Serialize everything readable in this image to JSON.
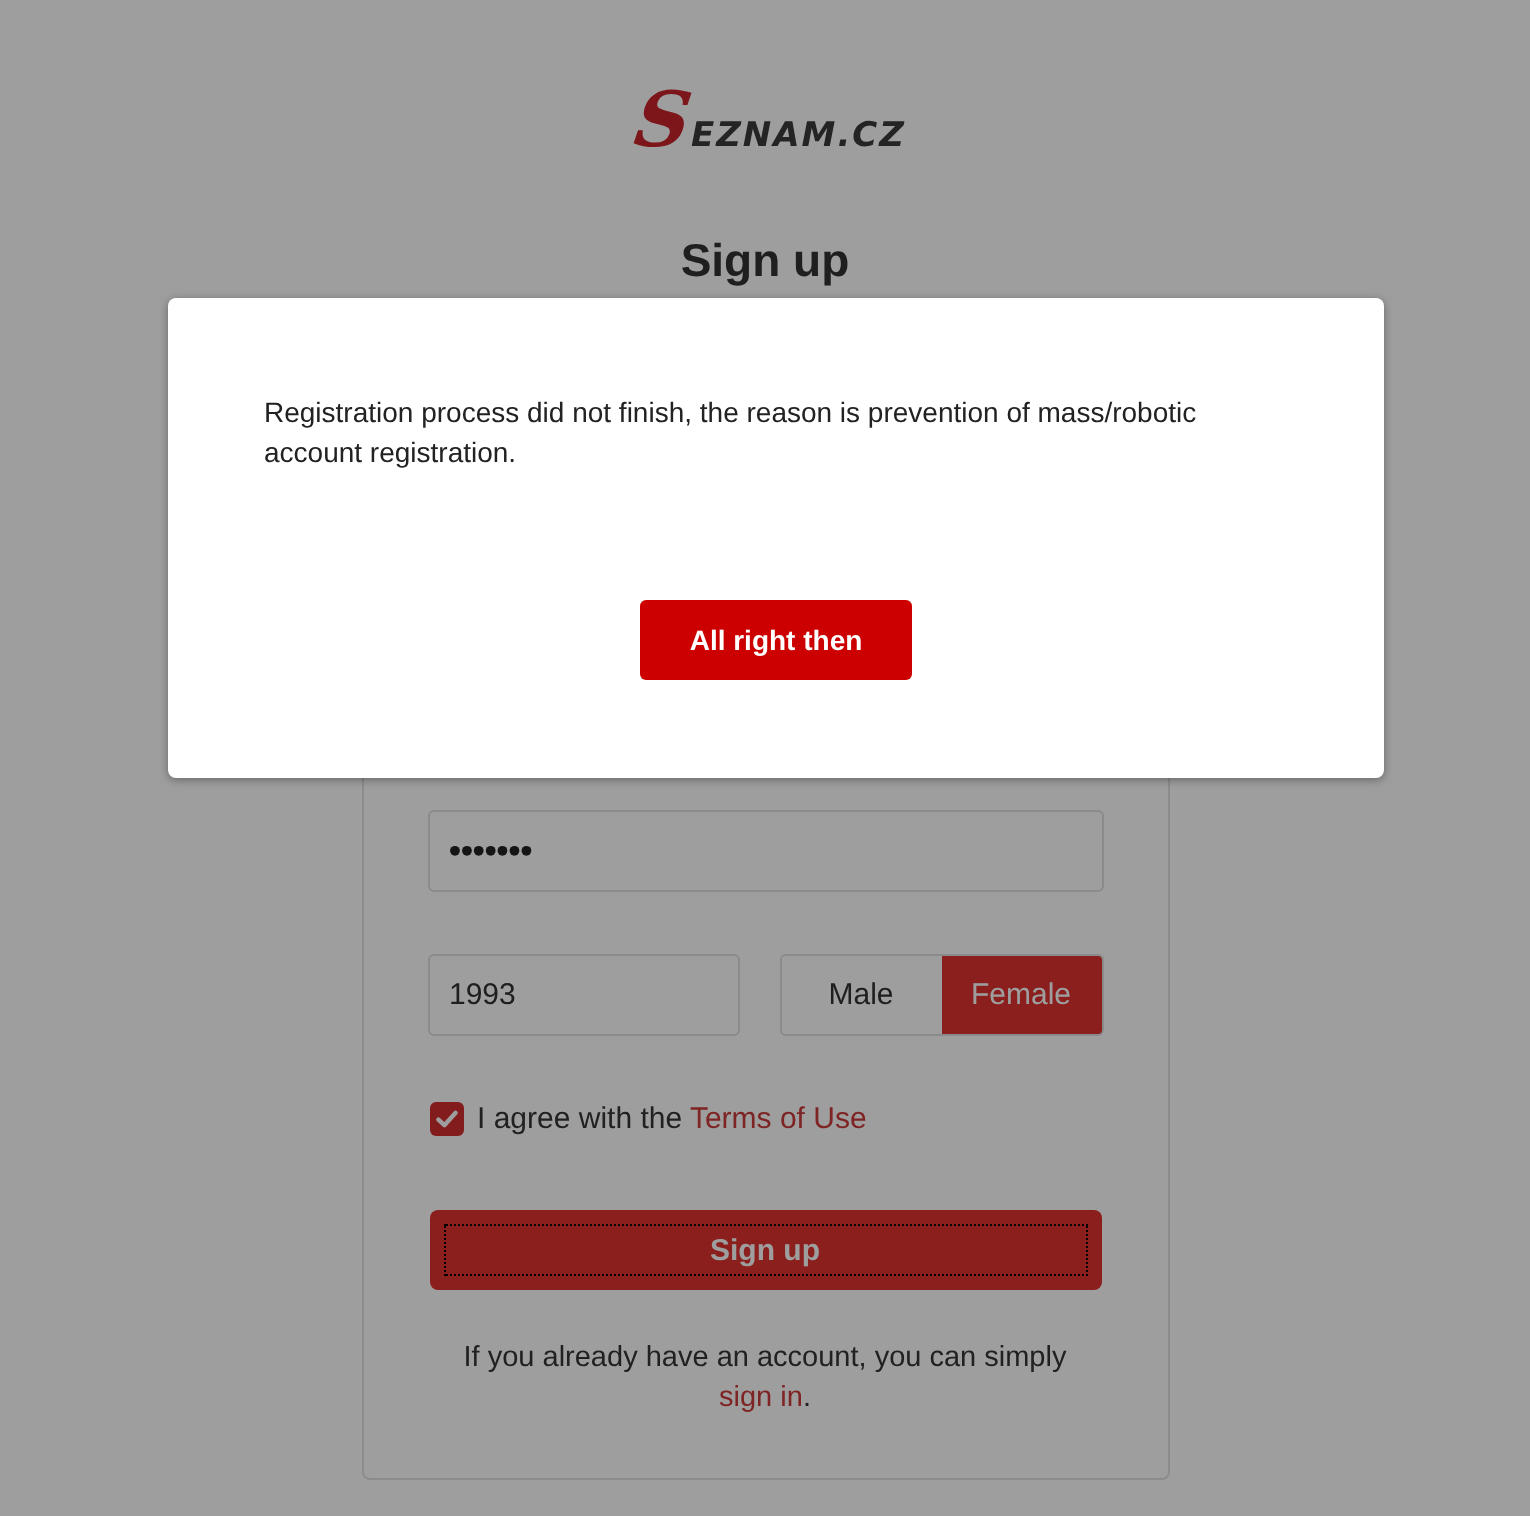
{
  "logo": "SEZNAM.CZ",
  "heading": "Sign up",
  "form": {
    "password": {
      "value": "•••••••"
    },
    "birth_year": {
      "value": "1993"
    },
    "gender": [
      {
        "label": "Male",
        "selected": false
      },
      {
        "label": "Female",
        "selected": true
      }
    ],
    "agreement": {
      "checked": true,
      "text": "I agree with the ",
      "link": "Terms of Use"
    },
    "submit": {
      "label": "Sign up",
      "focused": true
    },
    "sign_in_note": {
      "text": "If you already have an account, you can simply ",
      "link": "sign in",
      "end": "."
    }
  },
  "dialog": {
    "message": "Registration process did not finish, the reason is prevention of mass/robotic account registration.",
    "button": "All right then"
  }
}
